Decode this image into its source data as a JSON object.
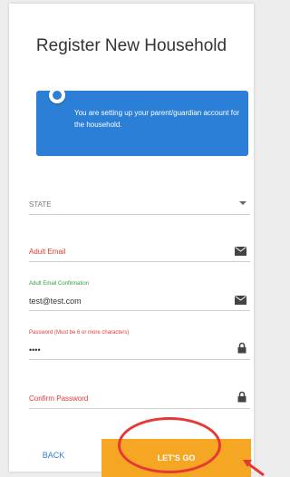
{
  "page": {
    "title": "Register New Household"
  },
  "info": {
    "message": "You are setting up your parent/guardian account for the household."
  },
  "fields": {
    "state": {
      "label": "STATE"
    },
    "adult_email": {
      "label": "Adult Email"
    },
    "email_confirm": {
      "label": "Adult Email Confirmation",
      "value": "test@test.com"
    },
    "password": {
      "label": "Password (Must be 6 or more characters)",
      "value": "••••"
    },
    "confirm_password": {
      "label": "Confirm Password"
    }
  },
  "buttons": {
    "back": "BACK",
    "go": "LET'S GO"
  },
  "colors": {
    "accent": "#2c7fd6",
    "error": "#e53935",
    "valid": "#2e9e44",
    "primary_button": "#f5a623",
    "annotation": "#e53935"
  },
  "icons": {
    "info": "info-icon",
    "dropdown": "chevron-down-icon",
    "mail": "mail-icon",
    "lock": "lock-icon"
  }
}
